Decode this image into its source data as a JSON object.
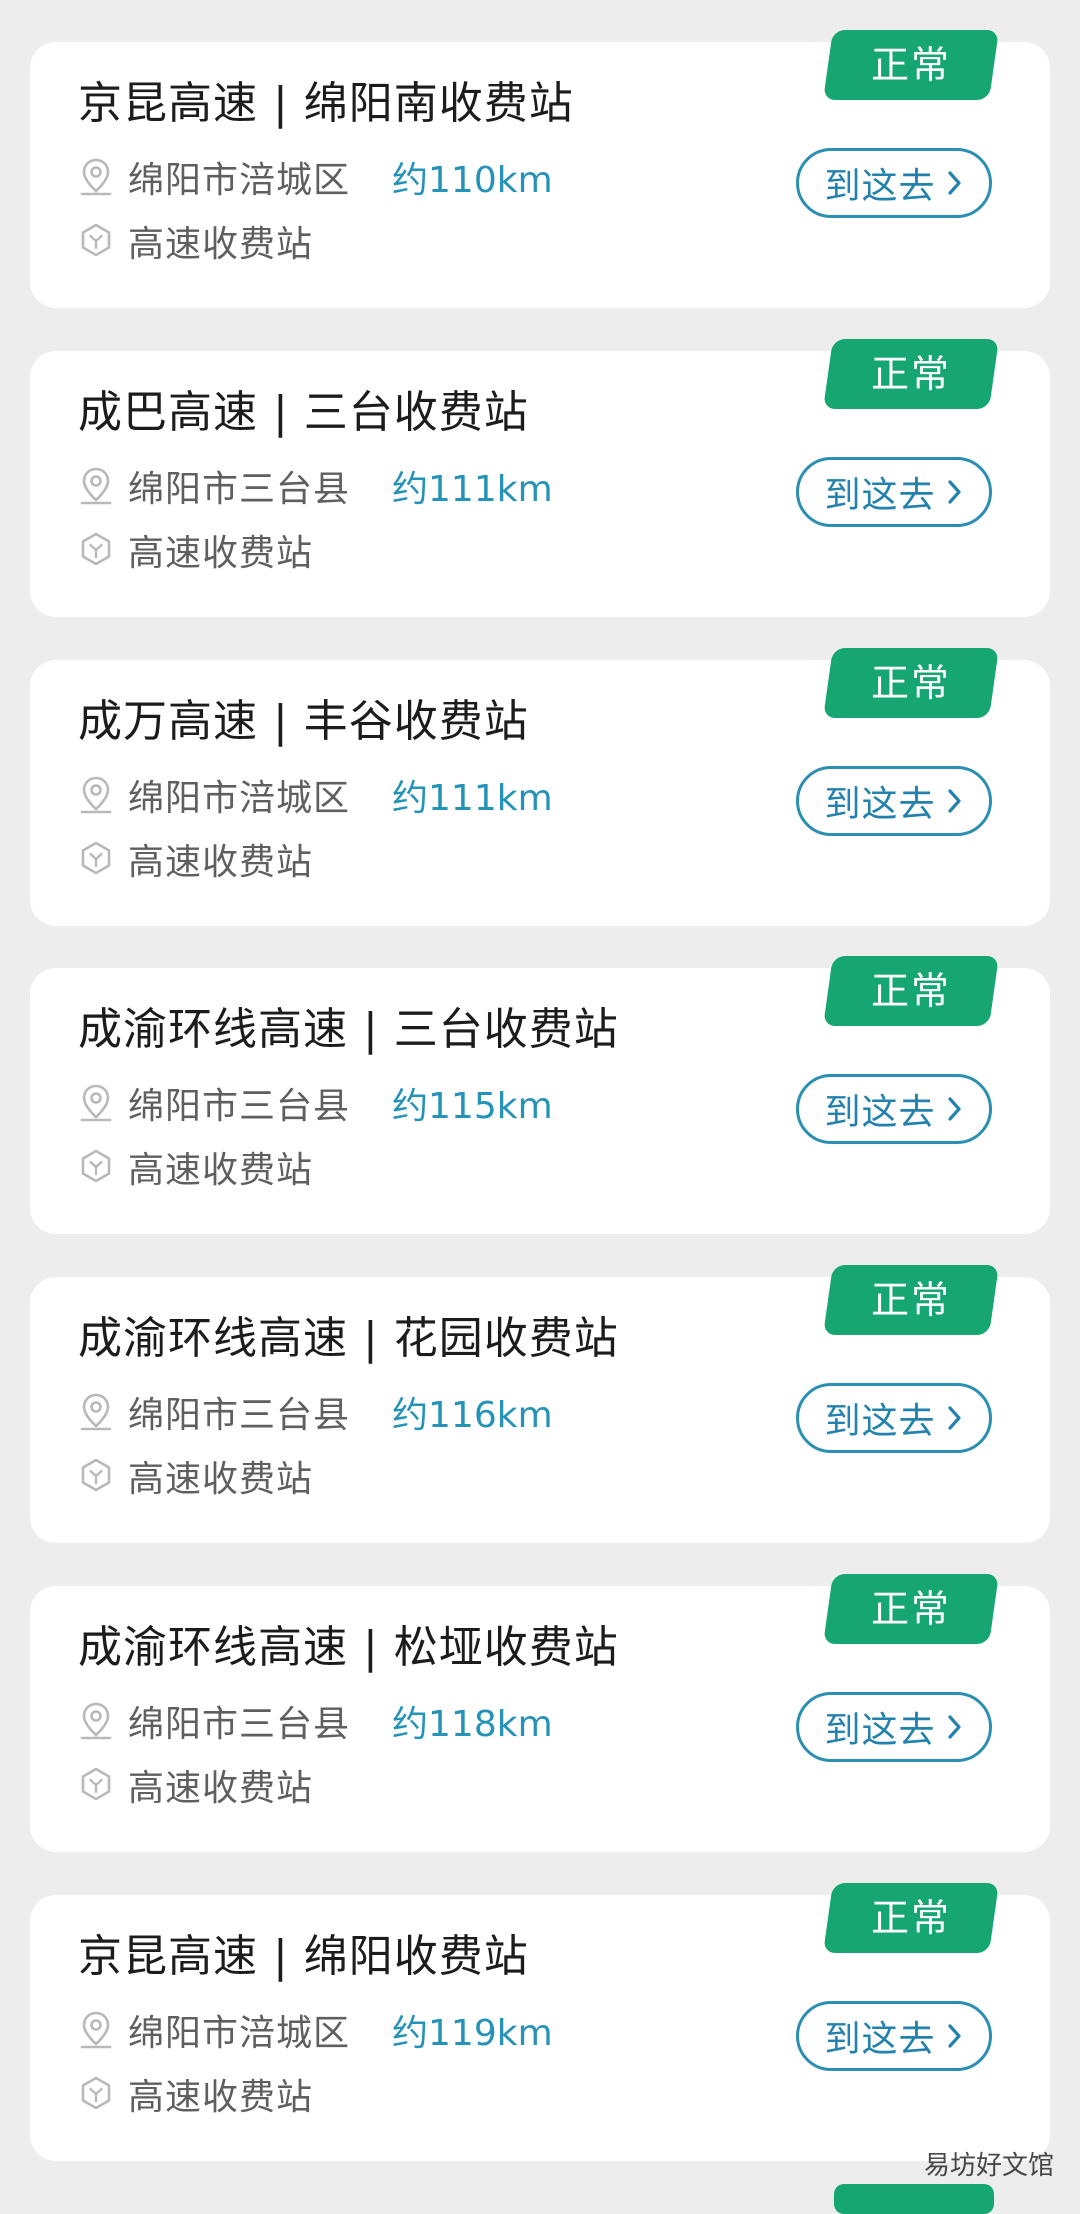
{
  "theme": {
    "status_color": "#16a672",
    "accent_color": "#2593b8",
    "card_bg": "#ffffff",
    "page_bg": "#ededed"
  },
  "icons": {
    "location": "location-pin-icon",
    "type": "hexagon-tag-icon",
    "chevron": "chevron-right-icon"
  },
  "stations": [
    {
      "title": "京昆高速 | 绵阳南收费站",
      "status": "正常",
      "location": "绵阳市涪城区",
      "distance": "约110km",
      "type": "高速收费站",
      "action": "到这去"
    },
    {
      "title": "成巴高速 | 三台收费站",
      "status": "正常",
      "location": "绵阳市三台县",
      "distance": "约111km",
      "type": "高速收费站",
      "action": "到这去"
    },
    {
      "title": "成万高速 | 丰谷收费站",
      "status": "正常",
      "location": "绵阳市涪城区",
      "distance": "约111km",
      "type": "高速收费站",
      "action": "到这去"
    },
    {
      "title": "成渝环线高速 | 三台收费站",
      "status": "正常",
      "location": "绵阳市三台县",
      "distance": "约115km",
      "type": "高速收费站",
      "action": "到这去"
    },
    {
      "title": "成渝环线高速 | 花园收费站",
      "status": "正常",
      "location": "绵阳市三台县",
      "distance": "约116km",
      "type": "高速收费站",
      "action": "到这去"
    },
    {
      "title": "成渝环线高速 | 松垭收费站",
      "status": "正常",
      "location": "绵阳市三台县",
      "distance": "约118km",
      "type": "高速收费站",
      "action": "到这去"
    },
    {
      "title": "京昆高速 | 绵阳收费站",
      "status": "正常",
      "location": "绵阳市涪城区",
      "distance": "约119km",
      "type": "高速收费站",
      "action": "到这去"
    }
  ],
  "watermark": "易坊好文馆"
}
